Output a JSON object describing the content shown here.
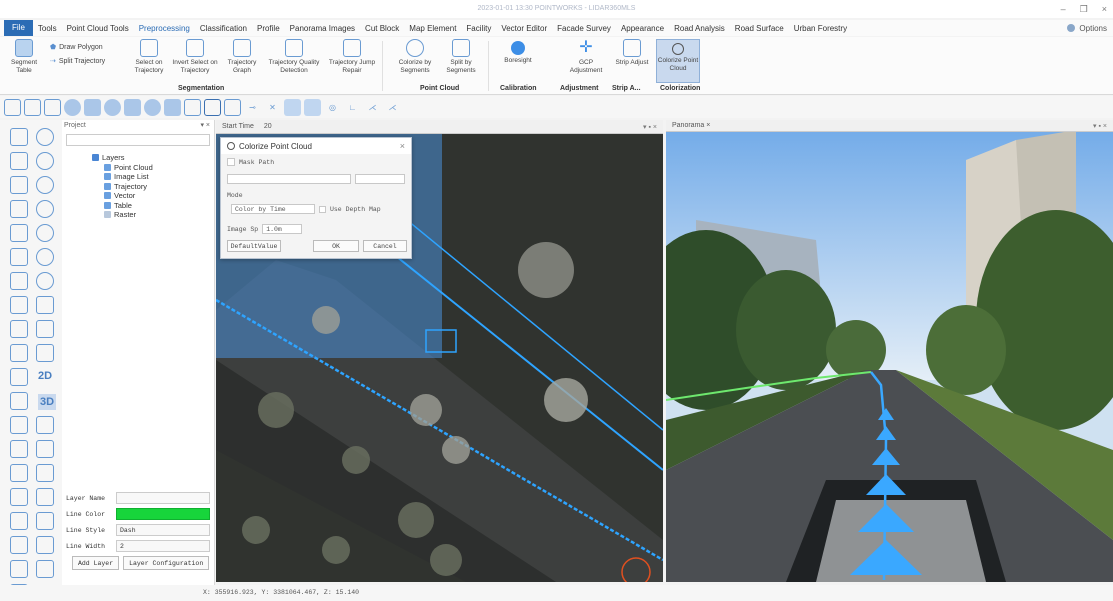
{
  "window": {
    "title": "2023-01-01 13:30 POINTWORKS - LIDAR360MLS",
    "min": "–",
    "max": "❐",
    "close": "×"
  },
  "menu": {
    "file": "File",
    "items": [
      "Tools",
      "Point Cloud Tools",
      "Preprocessing",
      "Classification",
      "Profile",
      "Panorama Images",
      "Cut Block",
      "Map Element",
      "Facility",
      "Vector Editor",
      "Facade Survey",
      "Appearance",
      "Road Analysis",
      "Road Surface",
      "Urban Forestry"
    ],
    "active": "Preprocessing",
    "options": "Options"
  },
  "ribbon": {
    "segment_table": "Segment Table",
    "draw_polygon": "Draw Polygon",
    "split_trajectory": "Split Trajectory",
    "select_on_trajectory": "Select on Trajectory",
    "invert_select": "Invert Select on Trajectory",
    "trajectory_graph": "Trajectory Graph",
    "trajectory_quality": "Trajectory Quality Detection",
    "trajectory_jump": "Trajectory Jump Repair",
    "colorize_by_segments": "Colorize by Segments",
    "split_by_segments": "Split by Segments",
    "boresight": "Boresight",
    "gcp_adjustment": "GCP Adjustment",
    "strip_adjust": "Strip Adjust",
    "colorize_point_cloud": "Colorize Point Cloud",
    "groups": {
      "segmentation": "Segmentation",
      "point_cloud": "Point Cloud",
      "calibration": "Calibration",
      "adjustment": "Adjustment",
      "strip": "Strip A...",
      "colorization": "Colorization"
    }
  },
  "project": {
    "header": "Project",
    "layers": "Layers",
    "items": [
      "Point Cloud",
      "Image List",
      "Trajectory",
      "Vector",
      "Table",
      "Raster"
    ]
  },
  "properties": {
    "layer_name_label": "Layer Name",
    "layer_name_value": "",
    "line_color_label": "Line Color",
    "line_style_label": "Line Style",
    "line_style_value": "Dash",
    "line_width_label": "Line Width",
    "line_width_value": "2",
    "add_layer": "Add Layer",
    "layer_configuration": "Layer Configuration",
    "line_color": "#17d53b"
  },
  "map": {
    "header": "Start Time",
    "value": "20",
    "pin": "▾ ▪ ×"
  },
  "panorama": {
    "header": "Panorama ×",
    "pin": "▾ ▪ ×"
  },
  "dialog": {
    "title": "Colorize Point Cloud",
    "mask_path": "Mask Path",
    "mode_label": "Mode",
    "mode_value": "Color by Time",
    "use_depth_map": "Use Depth Map",
    "image_sp_label": "Image Sp",
    "image_sp_value": "1.0m",
    "default_value": "DefaultValue",
    "ok": "OK",
    "cancel": "Cancel",
    "close": "×"
  },
  "left_panel": {
    "label_2d": "2D",
    "label_3d": "3D"
  },
  "status": {
    "coords": "X: 355916.923, Y: 3381064.467, Z: 15.140"
  }
}
